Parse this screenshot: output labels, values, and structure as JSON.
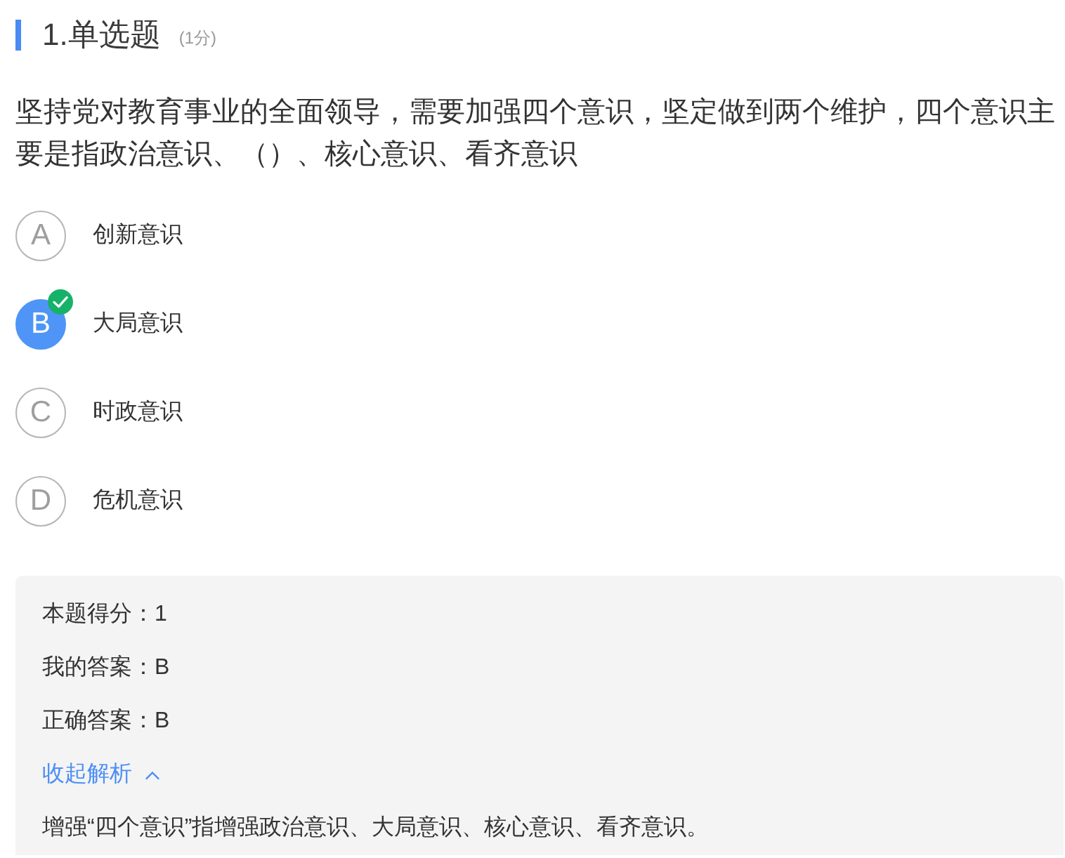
{
  "question": {
    "title": "1.单选题",
    "points": "(1分)",
    "text": "坚持党对教育事业的全面领导，需要加强四个意识，坚定做到两个维护，四个意识主要是指政治意识、（）、核心意识、看齐意识"
  },
  "options": [
    {
      "letter": "A",
      "text": "创新意识",
      "selected": false,
      "correct": false
    },
    {
      "letter": "B",
      "text": "大局意识",
      "selected": true,
      "correct": true
    },
    {
      "letter": "C",
      "text": "时政意识",
      "selected": false,
      "correct": false
    },
    {
      "letter": "D",
      "text": "危机意识",
      "selected": false,
      "correct": false
    }
  ],
  "result": {
    "score": "本题得分：1",
    "my_answer": "我的答案：B",
    "correct_answer": "正确答案：B",
    "toggle": {
      "label": "收起解析",
      "expanded": true
    },
    "analysis": "增强“四个意识”指增强政治意识、大局意识、核心意识、看齐意识。"
  }
}
